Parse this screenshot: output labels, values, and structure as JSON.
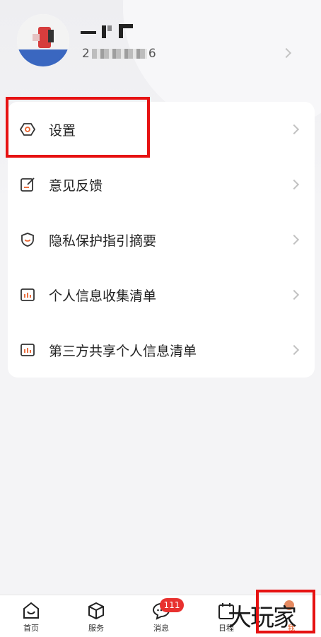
{
  "profile": {
    "name": "",
    "id_prefix": "2",
    "id_suffix": "6"
  },
  "menu": [
    {
      "label": "设置",
      "icon": "settings-icon"
    },
    {
      "label": "意见反馈",
      "icon": "feedback-icon"
    },
    {
      "label": "隐私保护指引摘要",
      "icon": "privacy-shield-icon"
    },
    {
      "label": "个人信息收集清单",
      "icon": "chart-list-icon"
    },
    {
      "label": "第三方共享个人信息清单",
      "icon": "chart-list-icon"
    }
  ],
  "tabbar": {
    "tabs": [
      {
        "label": "首页",
        "icon": "home-icon"
      },
      {
        "label": "服务",
        "icon": "cube-icon"
      },
      {
        "label": "消息",
        "icon": "chat-icon"
      },
      {
        "label": "日程",
        "icon": "calendar-icon"
      },
      {
        "label": "我",
        "icon": "profile-icon"
      }
    ],
    "message_badge": "111"
  },
  "watermark": "大玩家",
  "colors": {
    "accent": "#e8312f",
    "highlight": "#e61212",
    "icon_accent": "#e8612c"
  }
}
